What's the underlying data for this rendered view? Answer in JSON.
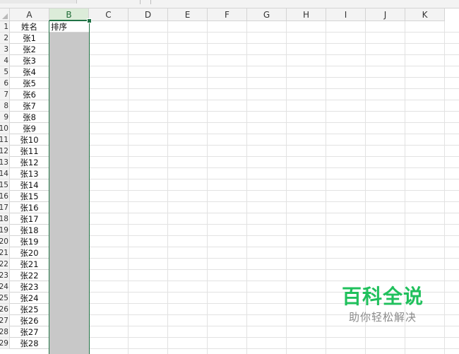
{
  "columns": [
    "A",
    "B",
    "C",
    "D",
    "E",
    "F",
    "G",
    "H",
    "I",
    "J",
    "K"
  ],
  "selected_column": "B",
  "row_numbers": [
    "1",
    "2",
    "3",
    "4",
    "5",
    "6",
    "7",
    "8",
    "9",
    "10",
    "11",
    "12",
    "13",
    "14",
    "15",
    "16",
    "17",
    "18",
    "19",
    "20",
    "21",
    "22",
    "23",
    "24",
    "25",
    "26",
    "27",
    "28",
    "29"
  ],
  "column_a": [
    "姓名",
    "张1",
    "张2",
    "张3",
    "张4",
    "张5",
    "张6",
    "张7",
    "张8",
    "张9",
    "张10",
    "张11",
    "张12",
    "张13",
    "张14",
    "张15",
    "张16",
    "张17",
    "张18",
    "张19",
    "张20",
    "张21",
    "张22",
    "张23",
    "张24",
    "张25",
    "张26",
    "张27",
    "张28"
  ],
  "column_b_header": "排序",
  "watermark": {
    "title": "百科全说",
    "subtitle": "助你轻松解决"
  },
  "colors": {
    "accent": "#217346",
    "selected_fill": "#c8c8c8",
    "watermark_green": "#20c05c"
  }
}
